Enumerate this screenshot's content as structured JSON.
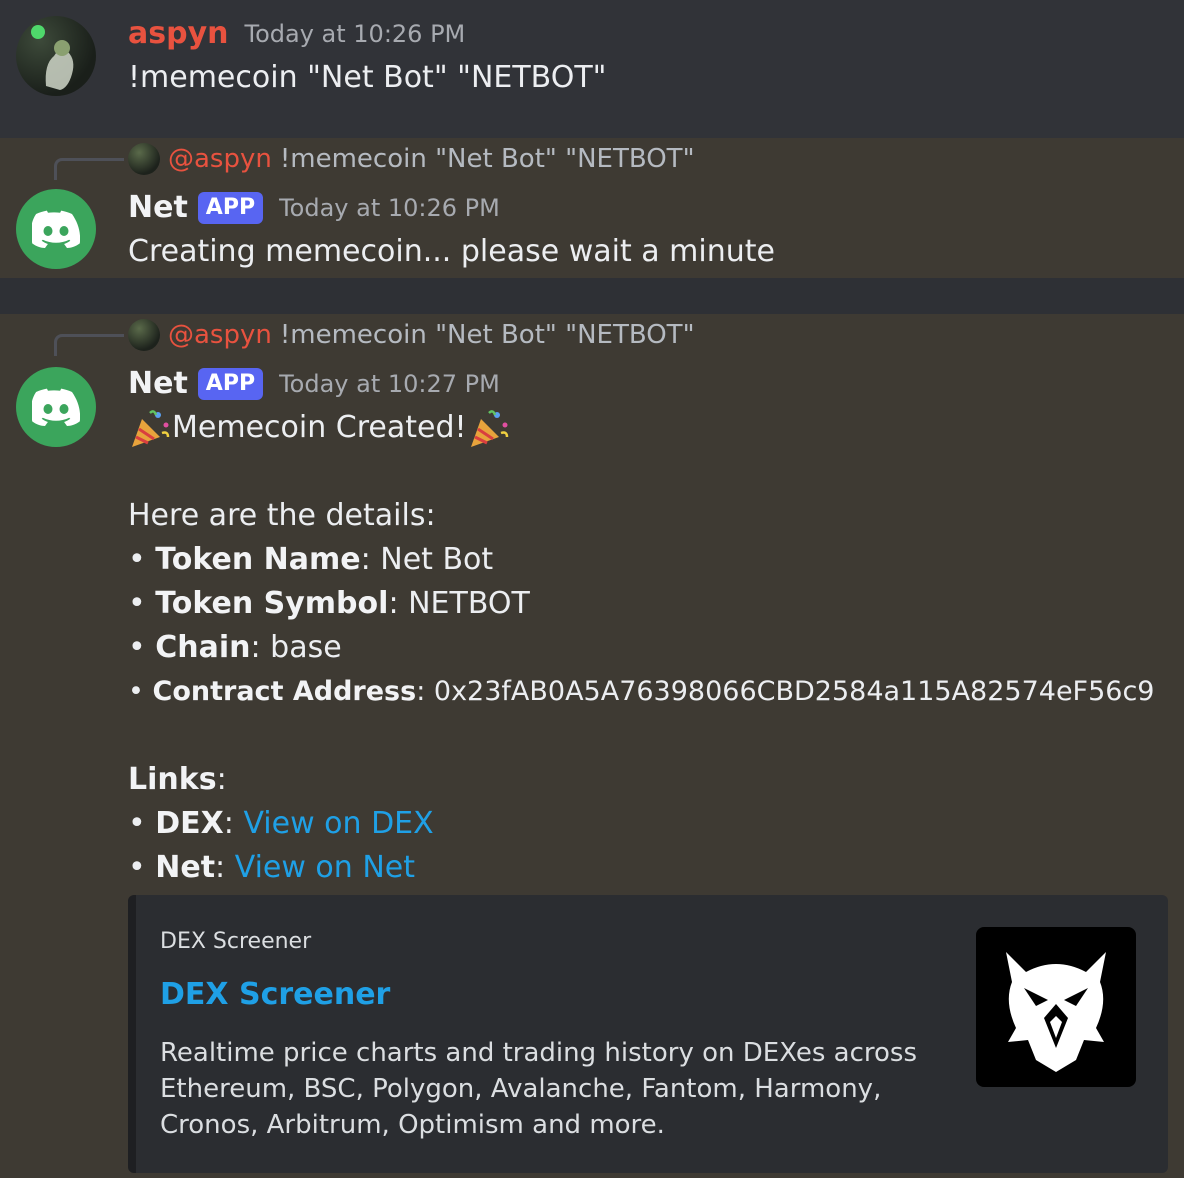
{
  "message1": {
    "username": "aspyn",
    "timestamp": "Today at 10:26 PM",
    "content": "!memecoin \"Net Bot\" \"NETBOT\""
  },
  "message2": {
    "reply": {
      "mention": "@aspyn",
      "text": "!memecoin \"Net Bot\" \"NETBOT\""
    },
    "username": "Net",
    "badge": "APP",
    "timestamp": "Today at 10:26 PM",
    "content": "Creating memecoin... please wait a minute"
  },
  "message3": {
    "reply": {
      "mention": "@aspyn",
      "text": "!memecoin \"Net Bot\" \"NETBOT\""
    },
    "username": "Net",
    "badge": "APP",
    "timestamp": "Today at 10:27 PM",
    "headline": "Memecoin Created!",
    "intro": "Here are the details:",
    "bullet": "•",
    "details": [
      {
        "label": "Token Name",
        "value": "Net Bot"
      },
      {
        "label": "Token Symbol",
        "value": "NETBOT"
      },
      {
        "label": "Chain",
        "value": "base"
      },
      {
        "label": "Contract Address",
        "value": "0x23fAB0A5A76398066CBD2584a115A82574eF56c9"
      }
    ],
    "links_heading": "Links",
    "links": [
      {
        "label": "DEX",
        "text": "View on DEX"
      },
      {
        "label": "Net",
        "text": "View on Net"
      }
    ],
    "embed": {
      "provider": "DEX Screener",
      "title": "DEX Screener",
      "description": "Realtime price charts and trading history on DEXes across Ethereum, BSC, Polygon, Avalanche, Fantom, Harmony, Cronos, Arbitrum, Optimism and more."
    }
  }
}
